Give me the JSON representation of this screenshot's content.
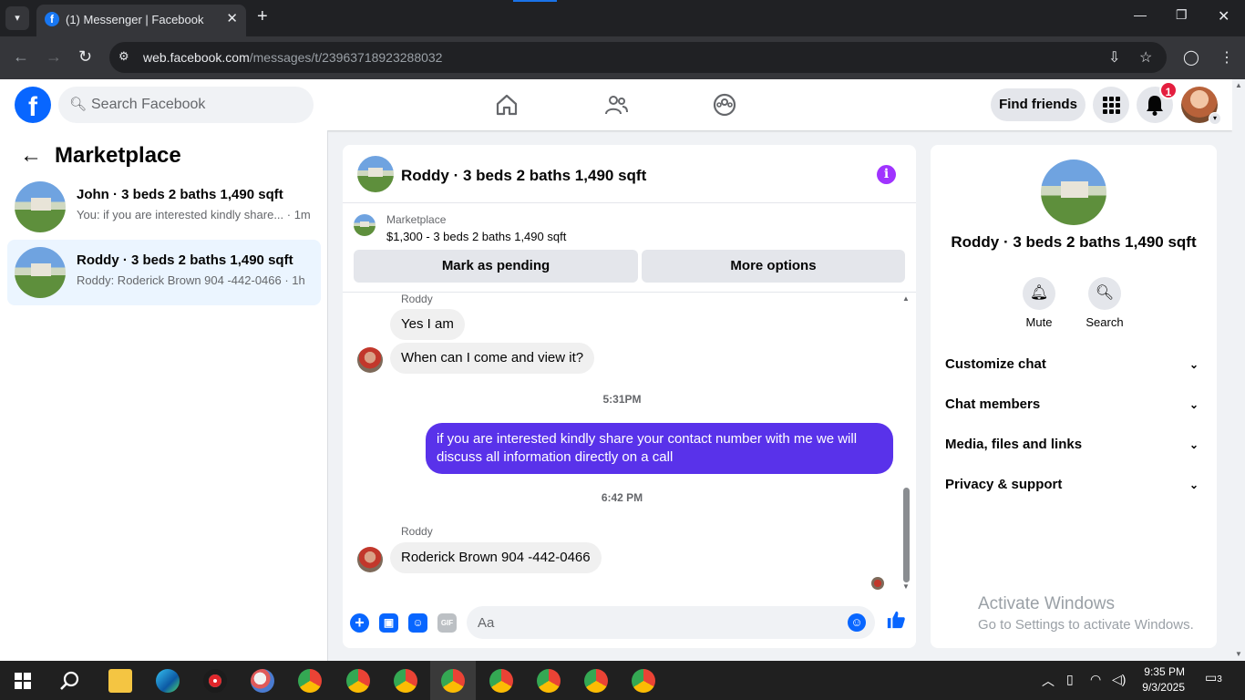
{
  "browser": {
    "tab_title": "(1) Messenger | Facebook",
    "url_host": "web.facebook.com",
    "url_path": "/messages/t/23963718923288032"
  },
  "fb": {
    "search_placeholder": "Search Facebook",
    "find_friends": "Find friends",
    "notification_count": "1"
  },
  "left": {
    "title": "Marketplace",
    "conversations": [
      {
        "name": "John · 3 beds 2 baths 1,490 sqft",
        "snippet": "You: if you are interested kindly share... · 1m"
      },
      {
        "name": "Roddy · 3 beds 2 baths 1,490 sqft",
        "snippet": "Roddy: Roderick Brown 904 -442-0466 · 1h"
      }
    ]
  },
  "chat": {
    "title": "Roddy · 3 beds 2 baths 1,490 sqft",
    "marketplace_label": "Marketplace",
    "listing": "$1,300 - 3 beds 2 baths 1,490 sqft",
    "mark_pending": "Mark as pending",
    "more_options": "More options",
    "sender1": "Roddy",
    "msg1": "Yes I am",
    "msg2": "When can I come and view it?",
    "time1": "5:31PM",
    "my_msg": "if you are interested kindly share your contact number with me we will discuss all information directly on a call",
    "time2": "6:42 PM",
    "sender2": "Roddy",
    "msg3": "Roderick Brown 904 -442-0466",
    "input_placeholder": "Aa"
  },
  "right": {
    "name": "Roddy · 3 beds 2 baths 1,490 sqft",
    "mute": "Mute",
    "search": "Search",
    "rows": [
      "Customize chat",
      "Chat members",
      "Media, files and links",
      "Privacy & support"
    ]
  },
  "watermark": {
    "line1": "Activate Windows",
    "line2": "Go to Settings to activate Windows."
  },
  "taskbar": {
    "time": "9:35 PM",
    "date": "9/3/2025",
    "notif": "3"
  }
}
